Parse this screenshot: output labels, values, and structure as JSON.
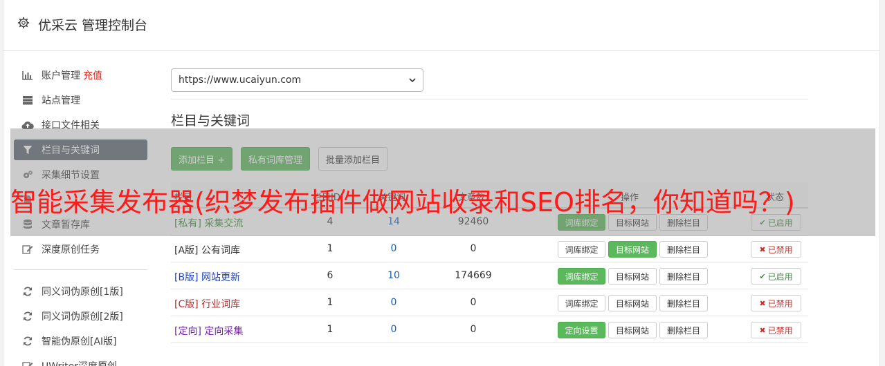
{
  "app": {
    "title": "优采云 管理控制台"
  },
  "sidebar": {
    "items": [
      {
        "label": "账户管理",
        "extra": "充值",
        "icon": "bar-chart-icon"
      },
      {
        "label": "站点管理",
        "icon": "server-icon"
      },
      {
        "label": "接口文件相关",
        "icon": "cloud-upload-icon"
      },
      {
        "label": "栏目与关键词",
        "icon": "filter-icon",
        "active": true
      },
      {
        "label": "采集细节设置",
        "icon": "gears-icon"
      },
      {
        "label": "",
        "icon": "file-icon"
      },
      {
        "label": "文章暂存库",
        "icon": "database-icon"
      },
      {
        "label": "深度原创任务",
        "icon": "edit-icon"
      }
    ],
    "items2": [
      {
        "label": "同义词伪原创[1版]",
        "icon": "refresh-icon"
      },
      {
        "label": "同义词伪原创[2版]",
        "icon": "refresh-icon"
      },
      {
        "label": "智能伪原创[AI版]",
        "icon": "refresh-icon"
      },
      {
        "label": "UWriter深度原创",
        "icon": "edit-icon"
      }
    ]
  },
  "main": {
    "site_select": "https://www.ucaiyun.com",
    "section_title": "栏目与关键词",
    "buttons": {
      "add": "添加栏目 +",
      "private": "私有词库管理",
      "batch": "批量添加栏目"
    },
    "table": {
      "headers": [
        "栏目",
        "栏目ID",
        "关键词",
        "文章数",
        "操作",
        "状态"
      ],
      "rows": [
        {
          "tag": "[私有]",
          "name": "采集交流",
          "color": "#3c8d3c",
          "n1": "4",
          "n2": "14",
          "n3": "92460",
          "bind": "词库绑定",
          "bind_green": true,
          "target": "目标网站",
          "target_green": false,
          "del": "删除栏目",
          "status": "已启用",
          "enabled": true
        },
        {
          "tag": "[A版]",
          "name": "公有词库",
          "color": "#333333",
          "n1": "1",
          "n2": "0",
          "n3": "0",
          "bind": "词库绑定",
          "bind_green": false,
          "target": "目标网站",
          "target_green": true,
          "del": "删除栏目",
          "status": "已禁用",
          "enabled": false
        },
        {
          "tag": "[B版]",
          "name": "网站更新",
          "color": "#1a3fc2",
          "n1": "6",
          "n2": "10",
          "n3": "174669",
          "bind": "词库绑定",
          "bind_green": true,
          "target": "目标网站",
          "target_green": false,
          "del": "删除栏目",
          "status": "已启用",
          "enabled": true
        },
        {
          "tag": "[C版]",
          "name": "行业词库",
          "color": "#b03030",
          "n1": "1",
          "n2": "0",
          "n3": "0",
          "bind": "词库绑定",
          "bind_green": false,
          "target": "目标网站",
          "target_green": false,
          "del": "删除栏目",
          "status": "已禁用",
          "enabled": false
        },
        {
          "tag": "[定向]",
          "name": "定向采集",
          "color": "#7a22b0",
          "n1": "1",
          "n2": "0",
          "n3": "0",
          "bind": "定向设置",
          "bind_green": true,
          "target": "目标网站",
          "target_green": false,
          "del": "删除栏目",
          "status": "已禁用",
          "enabled": false
        }
      ]
    }
  },
  "overlay": {
    "headline": "智能采集发布器(织梦发布插件做网站收录和SEO排名，你知道吗？)"
  },
  "colors": {
    "green": "#5cb85c",
    "active_nav": "#5c6670",
    "overlay_text": "#ff1a1a"
  }
}
